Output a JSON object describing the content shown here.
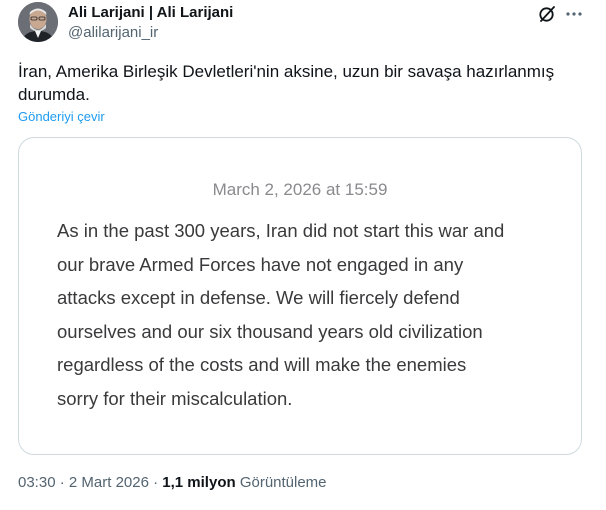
{
  "author": {
    "display_name": "Ali Larijani | Ali Larijani",
    "handle": "@alilarijani_ir"
  },
  "icons": {
    "avatar": "profile-photo",
    "grok": "grok-icon",
    "more": "more-icon"
  },
  "tweet": {
    "text": "İran, Amerika Birleşik Devletleri'nin aksine, uzun bir savaşa hazırlanmış durumda.",
    "translate_label": "Gönderiyi çevir"
  },
  "card": {
    "date": "March 2, 2026 at 15:59",
    "lines": [
      "As in the past 300 years, Iran did not start this war and",
      "our brave Armed Forces have not engaged in any",
      "attacks except in defense. We will fiercely defend",
      "ourselves and our six thousand years old civilization",
      "regardless of the costs and will make the enemies",
      "sorry for their miscalculation."
    ]
  },
  "meta": {
    "time": "03:30",
    "separator": "·",
    "date": "2 Mart 2026",
    "views_count": "1,1 milyon",
    "views_label": "Görüntüleme"
  },
  "colors": {
    "link": "#1d9bf0",
    "secondary_text": "#536471",
    "card_border": "#cfd9de"
  }
}
